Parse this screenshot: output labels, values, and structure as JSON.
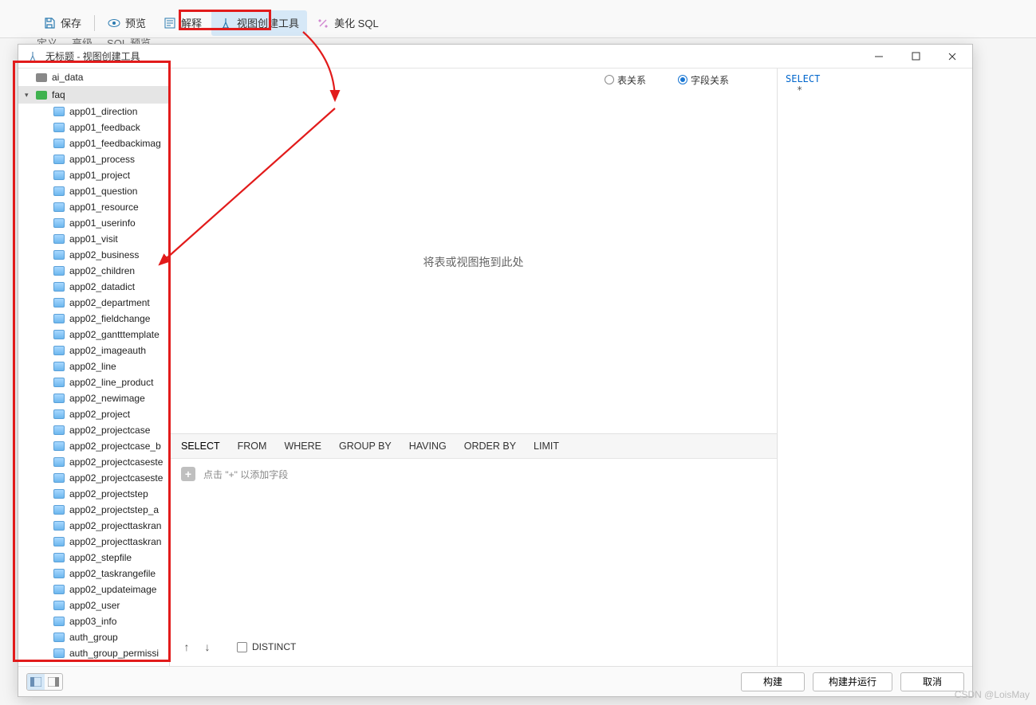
{
  "bg_toolbar": {
    "save": "保存",
    "preview": "预览",
    "explain": "解释",
    "view_builder": "视图创建工具",
    "beautify": "美化 SQL"
  },
  "bg_tabs": [
    "定义",
    "高级",
    "SQL 预览"
  ],
  "dialog": {
    "title": "无标题 - 视图创建工具"
  },
  "tree": {
    "db0": "ai_data",
    "db1": "faq",
    "tables": [
      "app01_direction",
      "app01_feedback",
      "app01_feedbackimag",
      "app01_process",
      "app01_project",
      "app01_question",
      "app01_resource",
      "app01_userinfo",
      "app01_visit",
      "app02_business",
      "app02_children",
      "app02_datadict",
      "app02_department",
      "app02_fieldchange",
      "app02_gantttemplate",
      "app02_imageauth",
      "app02_line",
      "app02_line_product",
      "app02_newimage",
      "app02_project",
      "app02_projectcase",
      "app02_projectcase_b",
      "app02_projectcaseste",
      "app02_projectcaseste",
      "app02_projectstep",
      "app02_projectstep_a",
      "app02_projecttaskran",
      "app02_projecttaskran",
      "app02_stepfile",
      "app02_taskrangefile",
      "app02_updateimage",
      "app02_user",
      "app03_info",
      "auth_group",
      "auth_group_permissi"
    ]
  },
  "relations": {
    "table_rel": "表关系",
    "field_rel": "字段关系"
  },
  "canvas_hint": "将表或视图拖到此处",
  "clauses": [
    "SELECT",
    "FROM",
    "WHERE",
    "GROUP BY",
    "HAVING",
    "ORDER BY",
    "LIMIT"
  ],
  "field_hint": "点击 \"+\" 以添加字段",
  "distinct_label": "DISTINCT",
  "sql": {
    "keyword": "SELECT",
    "body": "*"
  },
  "footer": {
    "build": "构建",
    "build_run": "构建并运行",
    "cancel": "取消"
  },
  "watermark": "CSDN @LoisMay"
}
